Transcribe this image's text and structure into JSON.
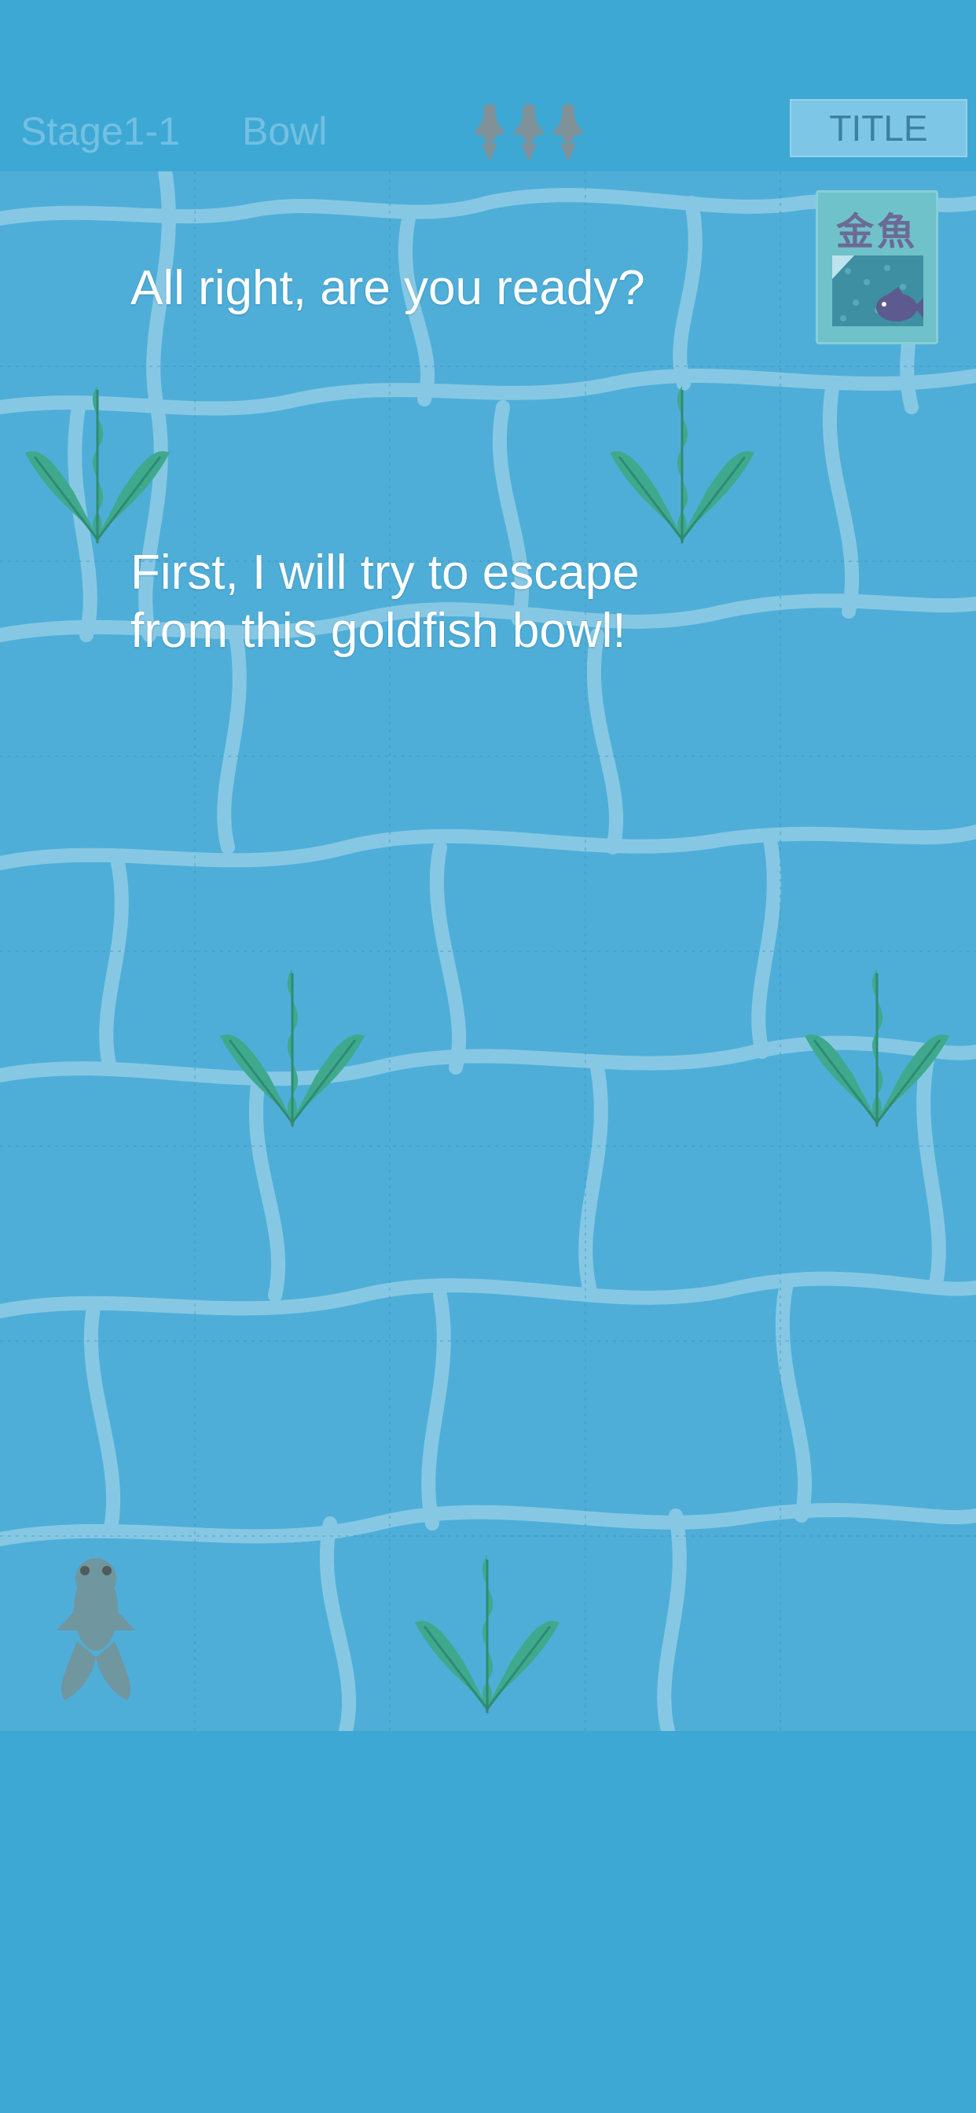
{
  "header": {
    "stage": "Stage1-1",
    "level_name": "Bowl",
    "lives_remaining": 3,
    "title_button": "TITLE"
  },
  "dialog": {
    "line1": "All right, are you ready?",
    "line2": "First, I will try to escape\nfrom this goldfish bowl!"
  },
  "card": {
    "kanji": "金魚",
    "icon": "goldfish-card-icon"
  },
  "colors": {
    "background": "#3ea8d4",
    "water": "#4faed8",
    "water_lines": "#8ccbe6",
    "seaweed": "#3fa98e",
    "card_fish": "#5c5a8e"
  }
}
